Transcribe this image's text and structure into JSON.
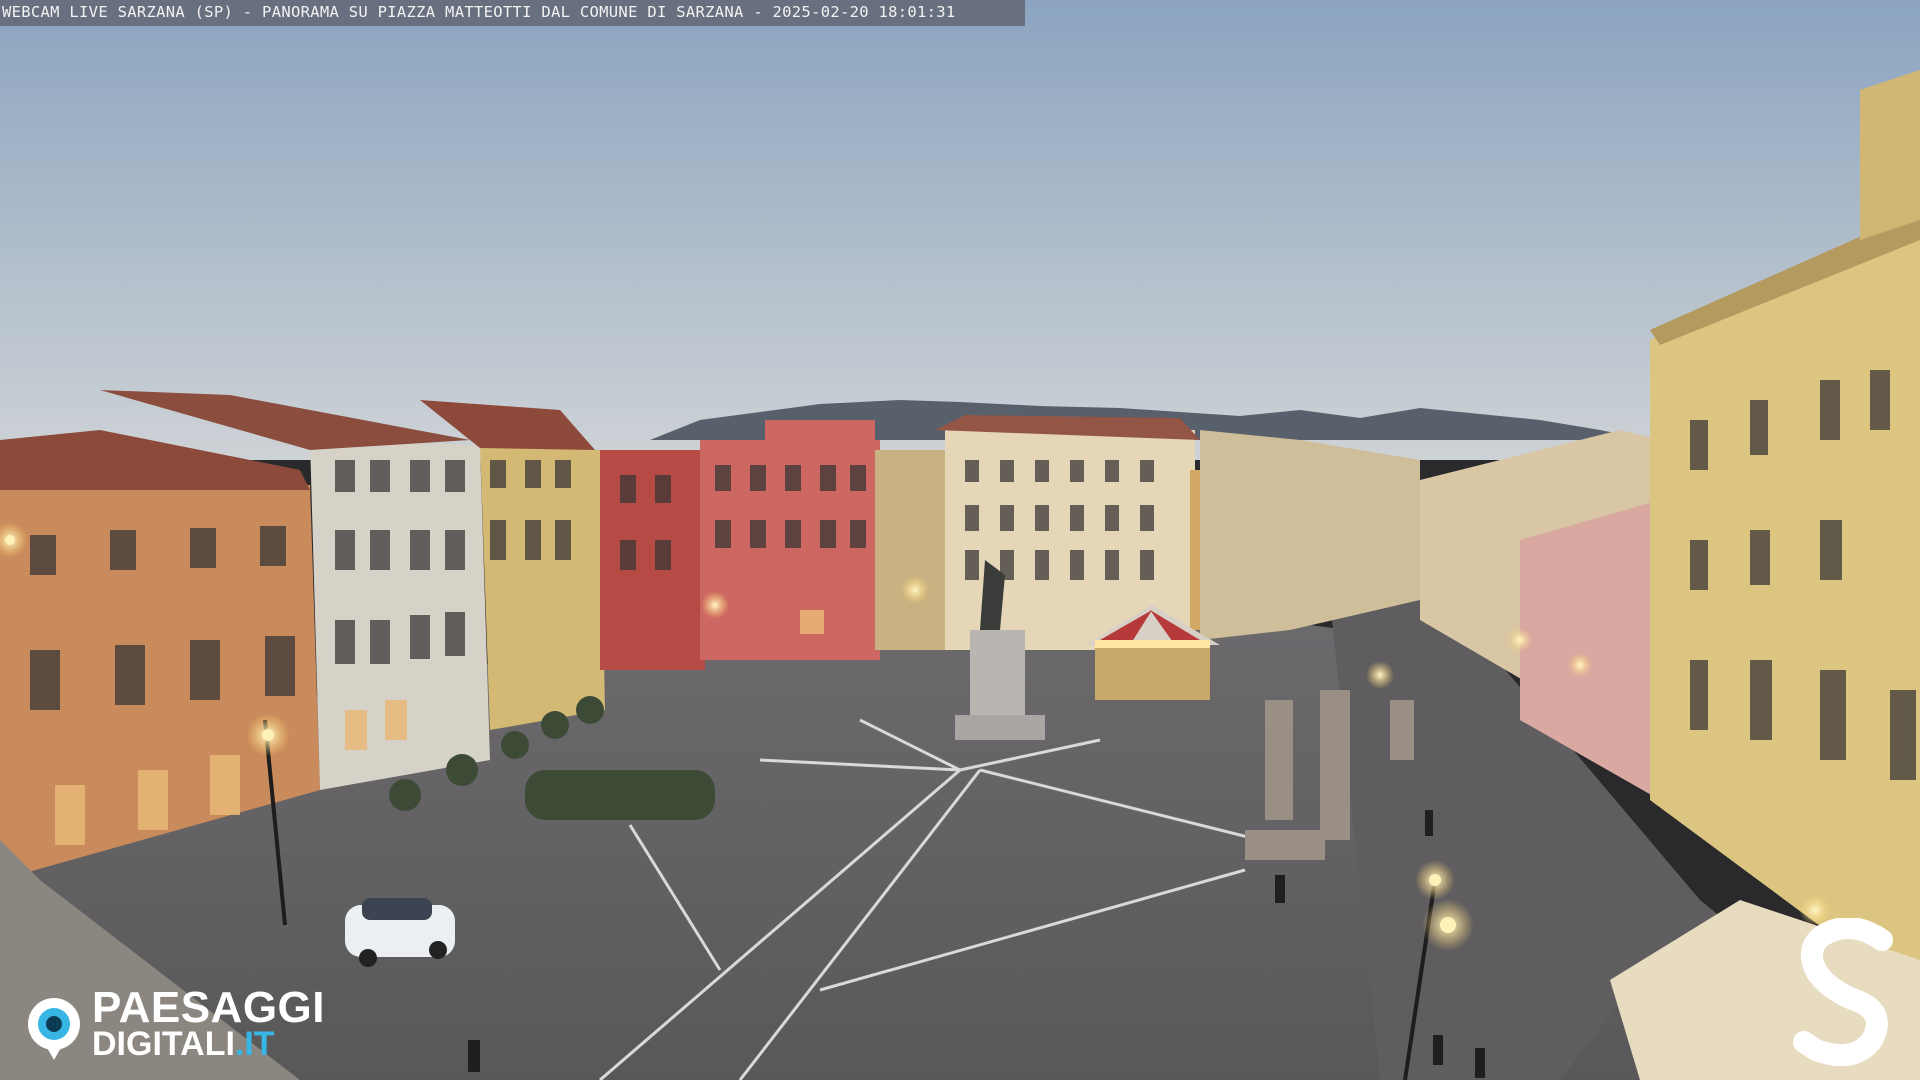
{
  "overlay": {
    "title": "WEBCAM LIVE SARZANA (SP) - PANORAMA SU PIAZZA MATTEOTTI DAL COMUNE DI SARZANA - 2025-02-20  18:01:31"
  },
  "logo": {
    "word1": "PAESAGGI",
    "word2": "DIGITALI",
    "suffix": ".IT",
    "mark_icon": "camera-lens-icon",
    "accent": "#37b6e6"
  },
  "brand_mark": {
    "icon": "letter-s-logo-icon",
    "color": "#ffffff"
  },
  "colors": {
    "sky_top": "#8aa3bf",
    "sky_bottom": "#c9d0d6",
    "pavement": "#6f6c6d",
    "facade_yellow": "#d8c27f",
    "facade_red": "#c2524c",
    "facade_pink": "#cf6a63",
    "facade_cream": "#e6d9bd",
    "roof": "#8d4a3a",
    "lamp": "#ffe7a1"
  }
}
